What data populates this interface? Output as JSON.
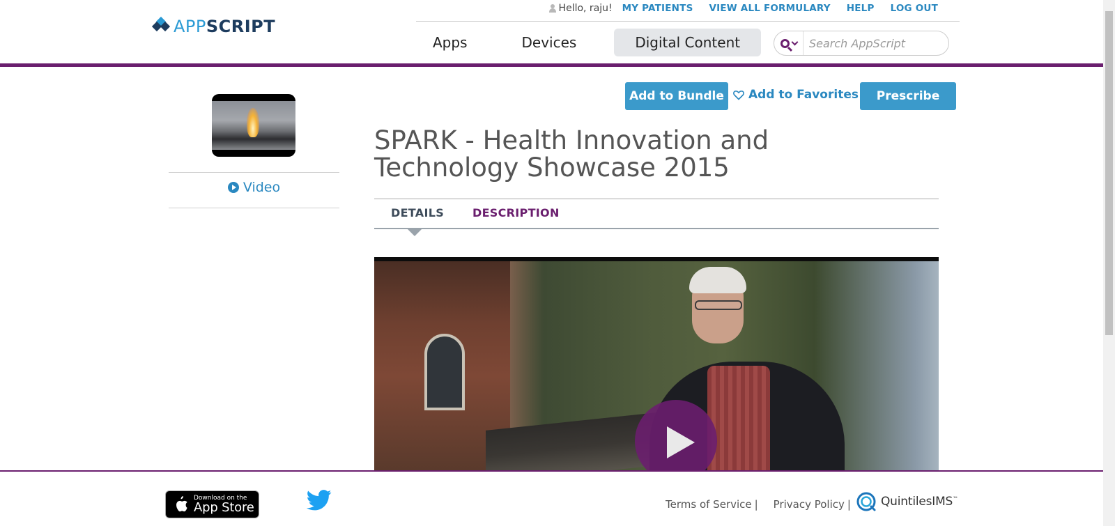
{
  "brand": {
    "name_part1": "APP",
    "name_part2": "SCRIPT"
  },
  "topbar": {
    "greeting": "Hello, raju!",
    "links": [
      "MY PATIENTS",
      "VIEW ALL FORMULARY",
      "HELP",
      "LOG OUT"
    ]
  },
  "nav": {
    "tabs": [
      "Apps",
      "Devices",
      "Digital Content"
    ],
    "active": "Digital Content"
  },
  "search": {
    "placeholder": "Search AppScript",
    "value": ""
  },
  "sidebar": {
    "media_link": "Video"
  },
  "actions": {
    "add_to_bundle": "Add to Bundle",
    "add_to_favorites": "Add to Favorites",
    "prescribe": "Prescribe"
  },
  "content": {
    "title": "SPARK - Health Innovation and Technology Showcase 2015",
    "tabs": [
      "DETAILS",
      "DESCRIPTION"
    ],
    "active_tab": "DETAILS"
  },
  "footer": {
    "appstore_small": "Download on the",
    "appstore_big": "App Store",
    "terms": "Terms of Service",
    "privacy": "Privacy Policy",
    "separator": "|",
    "partner": "QuintilesIMS",
    "partner_tm": "™"
  },
  "colors": {
    "accent_purple": "#6a1e6e",
    "button_blue": "#3b9acb",
    "link_blue": "#2a88c0",
    "brand_dark": "#1d3c5e"
  }
}
